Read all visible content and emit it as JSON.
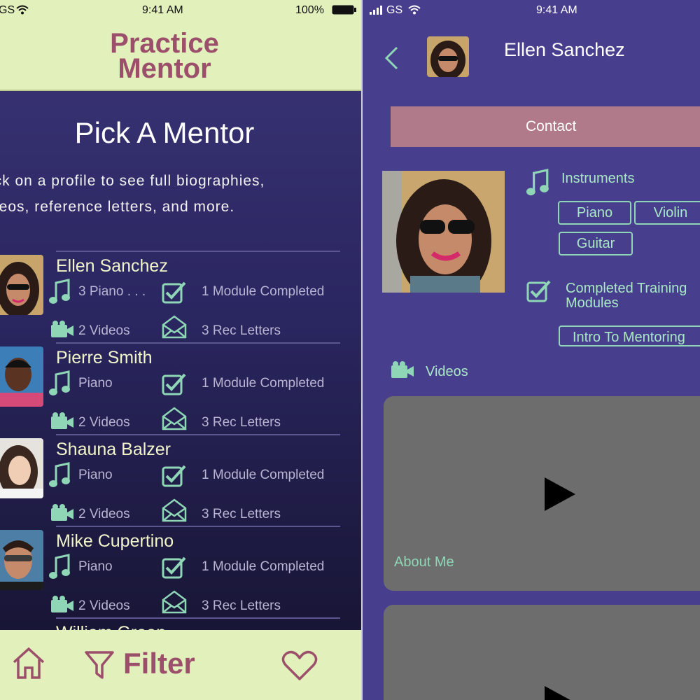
{
  "status_left": {
    "carrier": "GS",
    "time": "9:41 AM",
    "battery": "100%"
  },
  "status_right": {
    "carrier": "GS",
    "time": "9:41 AM"
  },
  "app": {
    "brand_line1": "Practice",
    "brand_line2": "Mentor"
  },
  "pick": {
    "title": "Pick A Mentor",
    "desc_line1": "ick on a profile to see full biographies,",
    "desc_line2": "deos, reference letters, and more."
  },
  "mentors": [
    {
      "name": "Ellen Sanchez",
      "instruments": "3 Piano . . .",
      "modules": "1 Module Completed",
      "videos": "2 Videos",
      "letters": "3 Rec Letters"
    },
    {
      "name": "Pierre Smith",
      "instruments": "Piano",
      "modules": "1 Module Completed",
      "videos": "2 Videos",
      "letters": "3 Rec Letters"
    },
    {
      "name": "Shauna Balzer",
      "instruments": "Piano",
      "modules": "1 Module Completed",
      "videos": "2 Videos",
      "letters": "3 Rec Letters"
    },
    {
      "name": "Mike Cupertino",
      "instruments": "Piano",
      "modules": "1 Module Completed",
      "videos": "2 Videos",
      "letters": "3 Rec Letters"
    },
    {
      "name": "William Green"
    }
  ],
  "bottom_nav": {
    "filter_label": "Filter"
  },
  "profile": {
    "name": "Ellen Sanchez",
    "contact_label": "Contact",
    "instruments_label": "Instruments",
    "instruments": [
      "Piano",
      "Violin",
      "Guitar"
    ],
    "completed_label_line1": "Completed Training",
    "completed_label_line2": "Modules",
    "module_tag": "Intro To Mentoring",
    "videos_label": "Videos",
    "video_caption": "About Me"
  },
  "colors": {
    "header_bg": "#e2f0bc",
    "brand": "#9c4f6a",
    "accent_green": "#8fd6b6",
    "profile_bg": "#473f8e",
    "contact_bg": "#b07a8a"
  }
}
